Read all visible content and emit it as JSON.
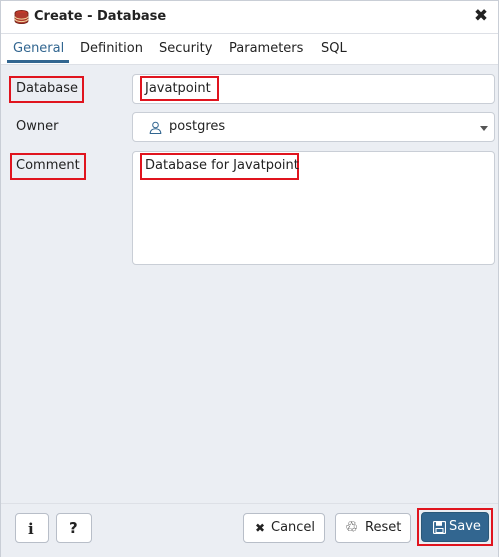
{
  "dialog": {
    "title": "Create - Database",
    "title_icon": "database-icon",
    "close_icon": "close-icon",
    "close_glyph": "✖"
  },
  "tabs": [
    {
      "label": "General",
      "active": true
    },
    {
      "label": "Definition",
      "active": false
    },
    {
      "label": "Security",
      "active": false
    },
    {
      "label": "Parameters",
      "active": false
    },
    {
      "label": "SQL",
      "active": false
    }
  ],
  "form": {
    "database_label": "Database",
    "database_value": "Javatpoint",
    "owner_label": "Owner",
    "owner_value": "postgres",
    "owner_icon": "user-icon",
    "comment_label": "Comment",
    "comment_value": "Database for Javatpoint"
  },
  "footer": {
    "info_icon": "info-icon",
    "info_glyph": "i",
    "help_icon": "help-icon",
    "help_glyph": "?",
    "cancel_label": "Cancel",
    "cancel_glyph": "✖",
    "reset_label": "Reset",
    "reset_glyph": "♲",
    "save_label": "Save"
  },
  "colors": {
    "accent": "#326690",
    "highlight": "#e0141e",
    "background": "#ebeef3"
  }
}
